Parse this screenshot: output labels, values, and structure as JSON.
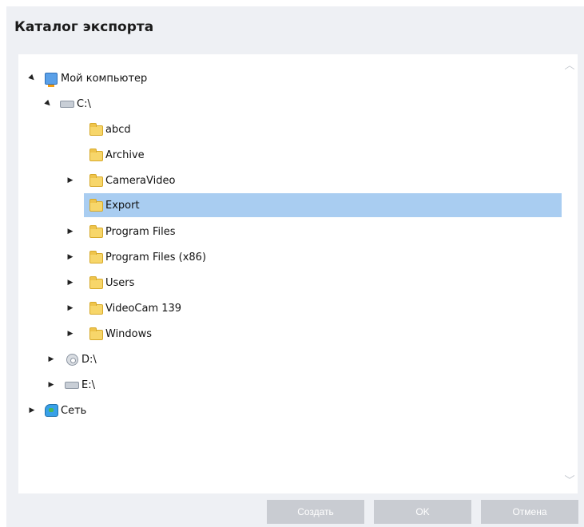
{
  "window": {
    "title": "Каталог экспорта"
  },
  "tree": [
    {
      "label": "Мой компьютер",
      "icon": "computer-icon",
      "expander": "expanded",
      "selected": false,
      "name": "tree-item-my-computer"
    },
    {
      "label": "C:\\",
      "icon": "drive-icon",
      "expander": "expanded",
      "selected": false,
      "name": "tree-item-drive-c"
    },
    {
      "label": "abcd",
      "icon": "folder-icon",
      "expander": "none",
      "selected": false,
      "name": "tree-item-abcd"
    },
    {
      "label": "Archive",
      "icon": "folder-icon",
      "expander": "none",
      "selected": false,
      "name": "tree-item-archive"
    },
    {
      "label": "CameraVideo",
      "icon": "folder-icon",
      "expander": "collapsed",
      "selected": false,
      "name": "tree-item-cameravideo"
    },
    {
      "label": "Export",
      "icon": "folder-icon",
      "expander": "none",
      "selected": true,
      "name": "tree-item-export"
    },
    {
      "label": "Program Files",
      "icon": "folder-icon",
      "expander": "collapsed",
      "selected": false,
      "name": "tree-item-program-files"
    },
    {
      "label": "Program Files (x86)",
      "icon": "folder-icon",
      "expander": "collapsed",
      "selected": false,
      "name": "tree-item-program-files-x86"
    },
    {
      "label": "Users",
      "icon": "folder-icon",
      "expander": "collapsed",
      "selected": false,
      "name": "tree-item-users"
    },
    {
      "label": "VideoCam 139",
      "icon": "folder-icon",
      "expander": "collapsed",
      "selected": false,
      "name": "tree-item-videocam-139"
    },
    {
      "label": "Windows",
      "icon": "folder-icon",
      "expander": "collapsed",
      "selected": false,
      "name": "tree-item-windows"
    },
    {
      "label": "D:\\",
      "icon": "cd-drive-icon",
      "expander": "collapsed",
      "selected": false,
      "name": "tree-item-drive-d"
    },
    {
      "label": "E:\\",
      "icon": "drive-icon",
      "expander": "collapsed",
      "selected": false,
      "name": "tree-item-drive-e"
    },
    {
      "label": "Сеть",
      "icon": "network-icon",
      "expander": "collapsed",
      "selected": false,
      "name": "tree-item-network"
    }
  ],
  "buttons": {
    "create": "Создать",
    "ok": "OK",
    "cancel": "Отмена"
  },
  "colors": {
    "dialog_bg": "#eef0f4",
    "selection": "#a9cdf1",
    "button_bg": "#c9ccd2"
  }
}
